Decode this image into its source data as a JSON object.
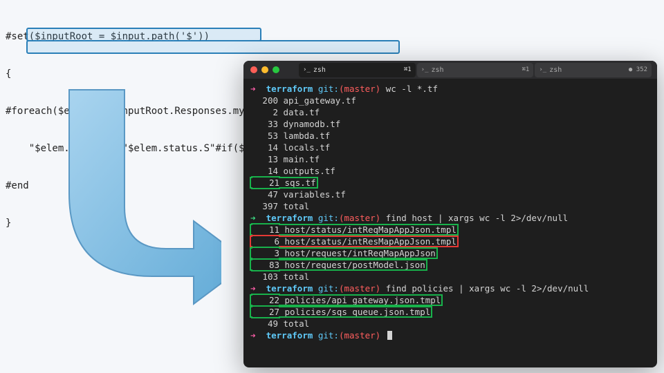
{
  "code": {
    "l1": "#set($inputRoot = $input.path('$'))",
    "l2": "{",
    "l3": "#foreach($elem in $inputRoot.Responses.mystatus-${user})",
    "l4indent": "    ",
    "l4": "\"$elem.host.S\": \"$elem.status.S\"#if($foreach.hasNext),#end",
    "l5": "#end",
    "l6": "}"
  },
  "tabs": [
    {
      "label": "zsh",
      "badge": "⌘1"
    },
    {
      "label": "zsh",
      "badge": "⌘1"
    },
    {
      "label": "zsh",
      "badge": "● 352"
    }
  ],
  "prompt": {
    "arrow": "➜",
    "dir": "terraform",
    "git_label": "git:",
    "branch": "(master)",
    "cross": "✗"
  },
  "commands": {
    "c1": "wc -l *.tf",
    "c2": "find host | xargs wc -l 2>/dev/null",
    "c3": "find policies | xargs wc -l 2>/dev/null",
    "c4": ""
  },
  "wc_tf": [
    {
      "n": "200",
      "f": "api_gateway.tf"
    },
    {
      "n": "2",
      "f": "data.tf"
    },
    {
      "n": "33",
      "f": "dynamodb.tf"
    },
    {
      "n": "53",
      "f": "lambda.tf"
    },
    {
      "n": "14",
      "f": "locals.tf"
    },
    {
      "n": "13",
      "f": "main.tf"
    },
    {
      "n": "14",
      "f": "outputs.tf"
    },
    {
      "n": "21",
      "f": "sqs.tf",
      "hl": "green"
    },
    {
      "n": "47",
      "f": "variables.tf"
    },
    {
      "n": "397",
      "f": "total"
    }
  ],
  "wc_host": [
    {
      "n": "11",
      "f": "host/status/intReqMapAppJson.tmpl",
      "hl": "green"
    },
    {
      "n": "6",
      "f": "host/status/intResMapAppJson.tmpl",
      "hl": "red"
    },
    {
      "n": "3",
      "f": "host/request/intReqMapAppJson",
      "hl": "green"
    },
    {
      "n": "83",
      "f": "host/request/postModel.json",
      "hl": "green"
    },
    {
      "n": "103",
      "f": "total"
    }
  ],
  "wc_pol": [
    {
      "n": "22",
      "f": "policies/api_gateway.json.tmpl",
      "hl": "green"
    },
    {
      "n": "27",
      "f": "policies/sqs_queue.json.tmpl",
      "hl": "green"
    },
    {
      "n": "49",
      "f": "total"
    }
  ]
}
